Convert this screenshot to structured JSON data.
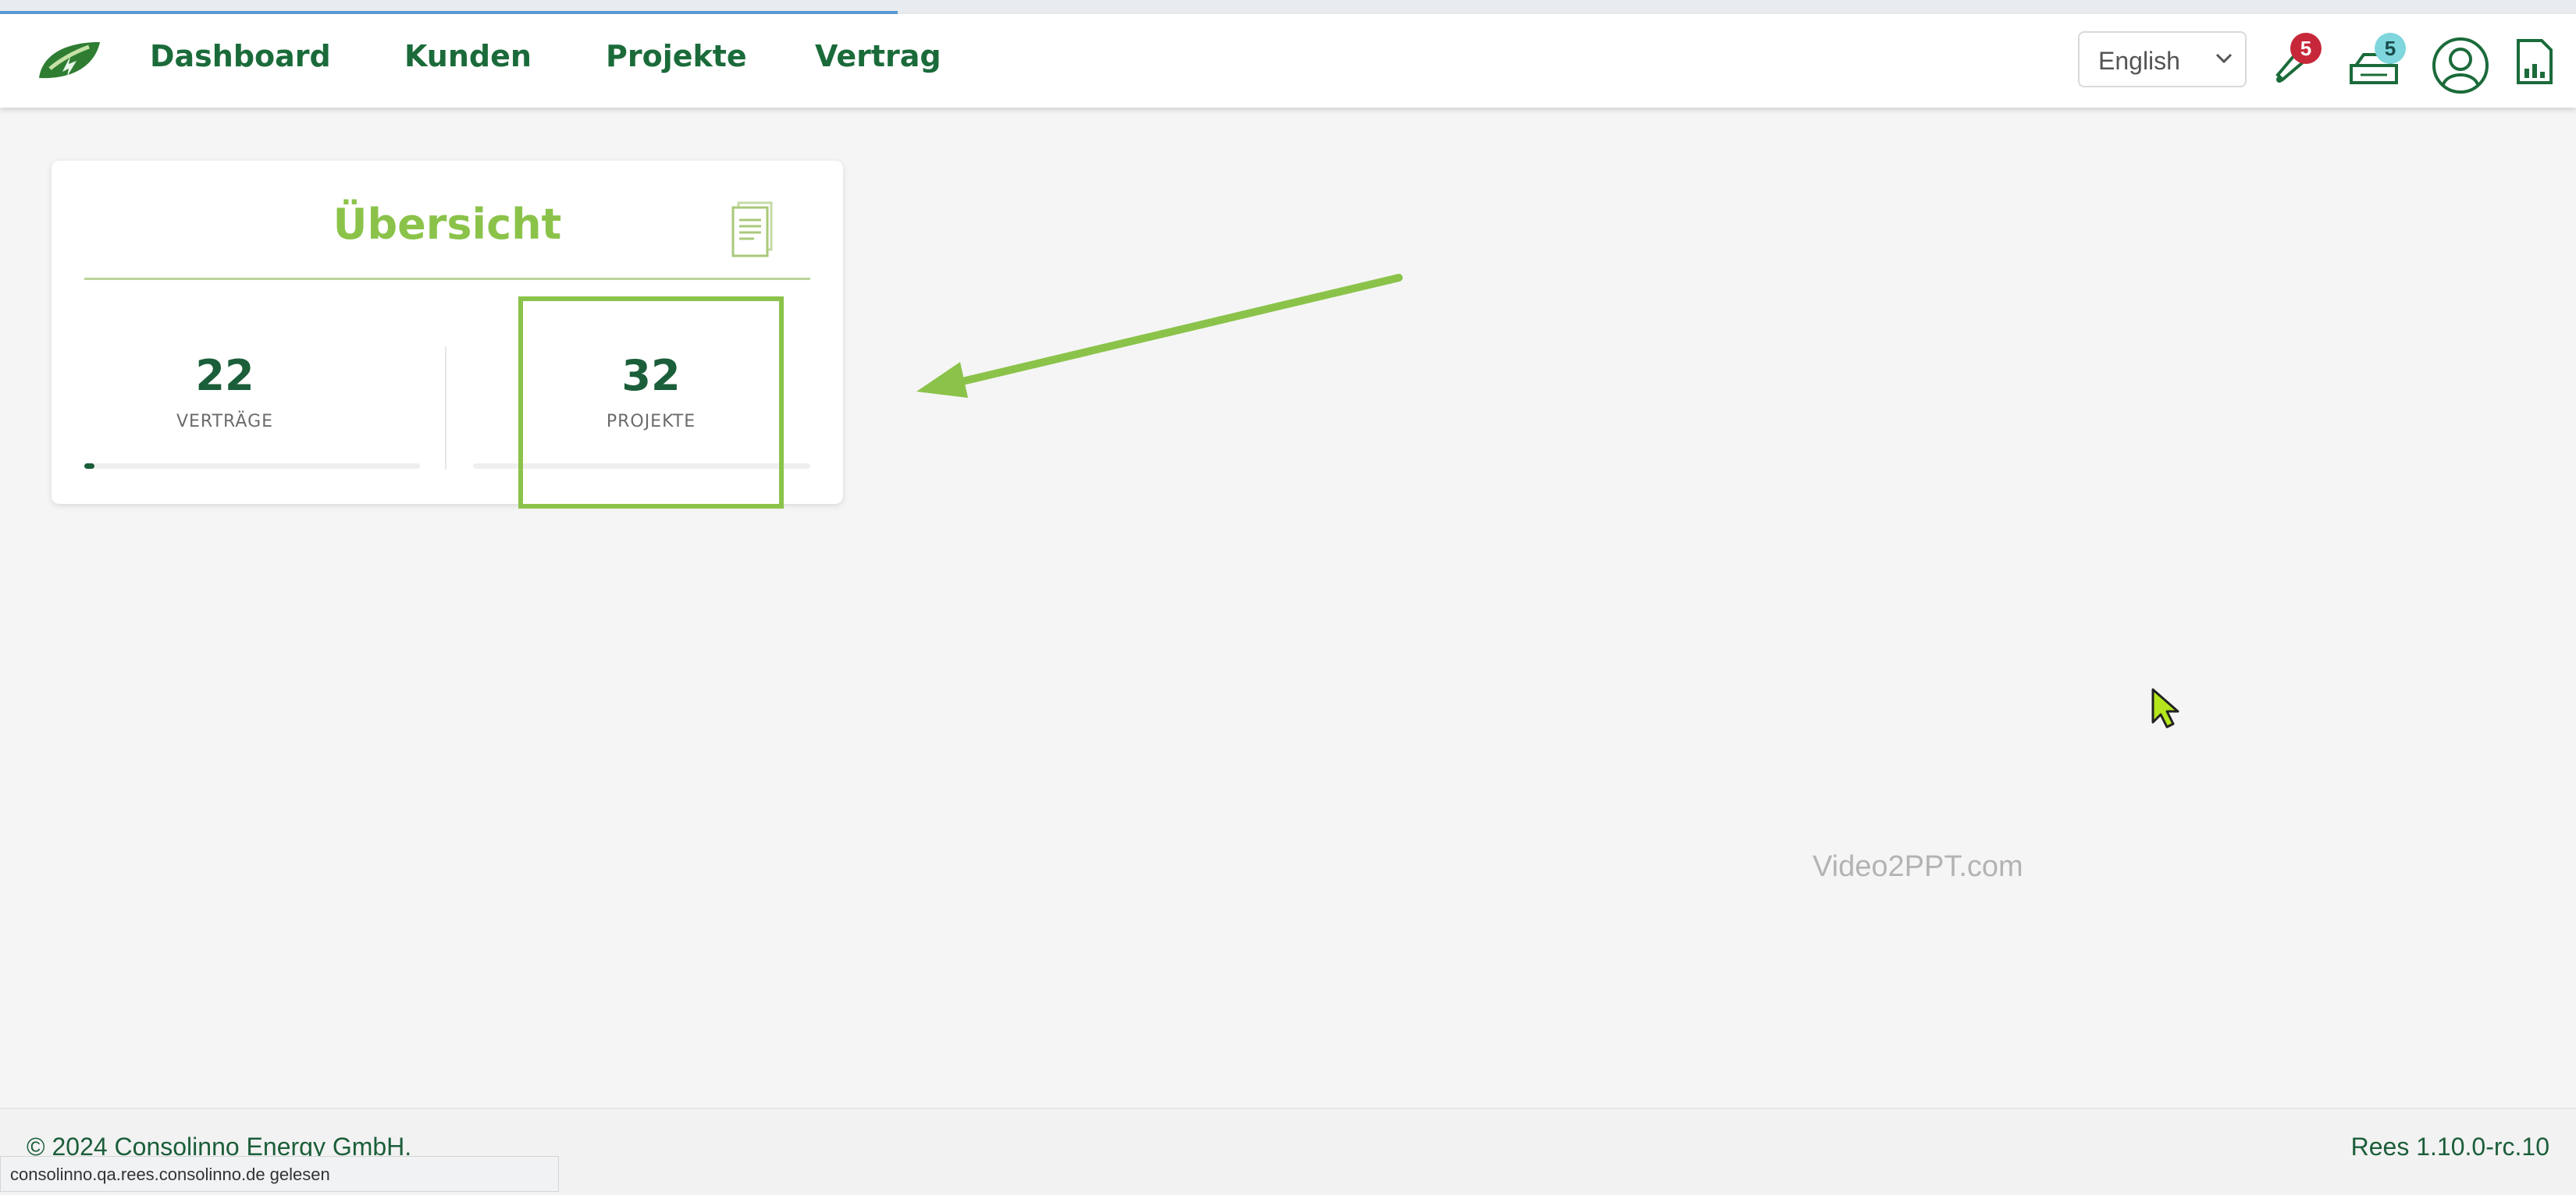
{
  "nav": {
    "logo": "leaf-logo",
    "links": [
      "Dashboard",
      "Kunden",
      "Projekte",
      "Vertrag"
    ],
    "language": "English",
    "notifications_count": "5",
    "messages_count": "5"
  },
  "overview": {
    "title": "Übersicht",
    "stats": [
      {
        "value": "22",
        "label": "VERTRÄGE",
        "progress": 0.03
      },
      {
        "value": "32",
        "label": "PROJEKTE",
        "progress": 0.0
      }
    ]
  },
  "watermark": "Video2PPT.com",
  "footer": {
    "copyright": "© 2024 Consolinno Energy GmbH.",
    "version": "Rees 1.10.0-rc.10"
  },
  "status_bar": "consolinno.qa.rees.consolinno.de gelesen",
  "colors": {
    "brand_green": "#1b6b3a",
    "accent_green": "#8bc34a",
    "badge_red": "#c62839",
    "badge_teal": "#7fd6dd"
  }
}
